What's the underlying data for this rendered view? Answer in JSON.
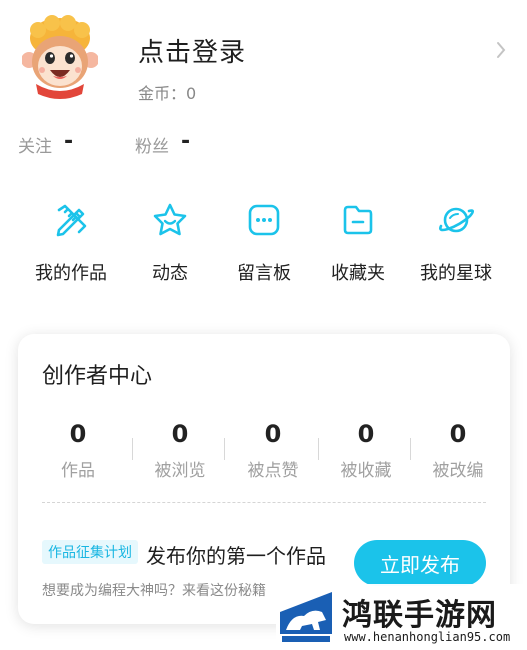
{
  "profile": {
    "login_text": "点击登录",
    "coins_label": "金币：0",
    "follow_label": "关注",
    "follow_value": "-",
    "fans_label": "粉丝",
    "fans_value": "-"
  },
  "menu": {
    "items": [
      {
        "label": "我的作品",
        "icon": "pencil-ruler-icon"
      },
      {
        "label": "动态",
        "icon": "star-icon"
      },
      {
        "label": "留言板",
        "icon": "message-board-icon"
      },
      {
        "label": "收藏夹",
        "icon": "folder-icon"
      },
      {
        "label": "我的星球",
        "icon": "planet-icon"
      }
    ]
  },
  "creator_center": {
    "title": "创作者中心",
    "stats": [
      {
        "value": "0",
        "label": "作品"
      },
      {
        "value": "0",
        "label": "被浏览"
      },
      {
        "value": "0",
        "label": "被点赞"
      },
      {
        "value": "0",
        "label": "被收藏"
      },
      {
        "value": "0",
        "label": "被改编"
      }
    ],
    "badge": "作品征集计划",
    "cta_title": "发布你的第一个作品",
    "cta_subtitle": "想要成为编程大神吗？来看这份秘籍",
    "publish_button": "立即发布"
  },
  "watermark": {
    "title": "鸿联手游网",
    "url": "www.henanhonglian95.com"
  },
  "colors": {
    "accent": "#1bc3ea",
    "badge_bg": "#e6f8fd"
  }
}
